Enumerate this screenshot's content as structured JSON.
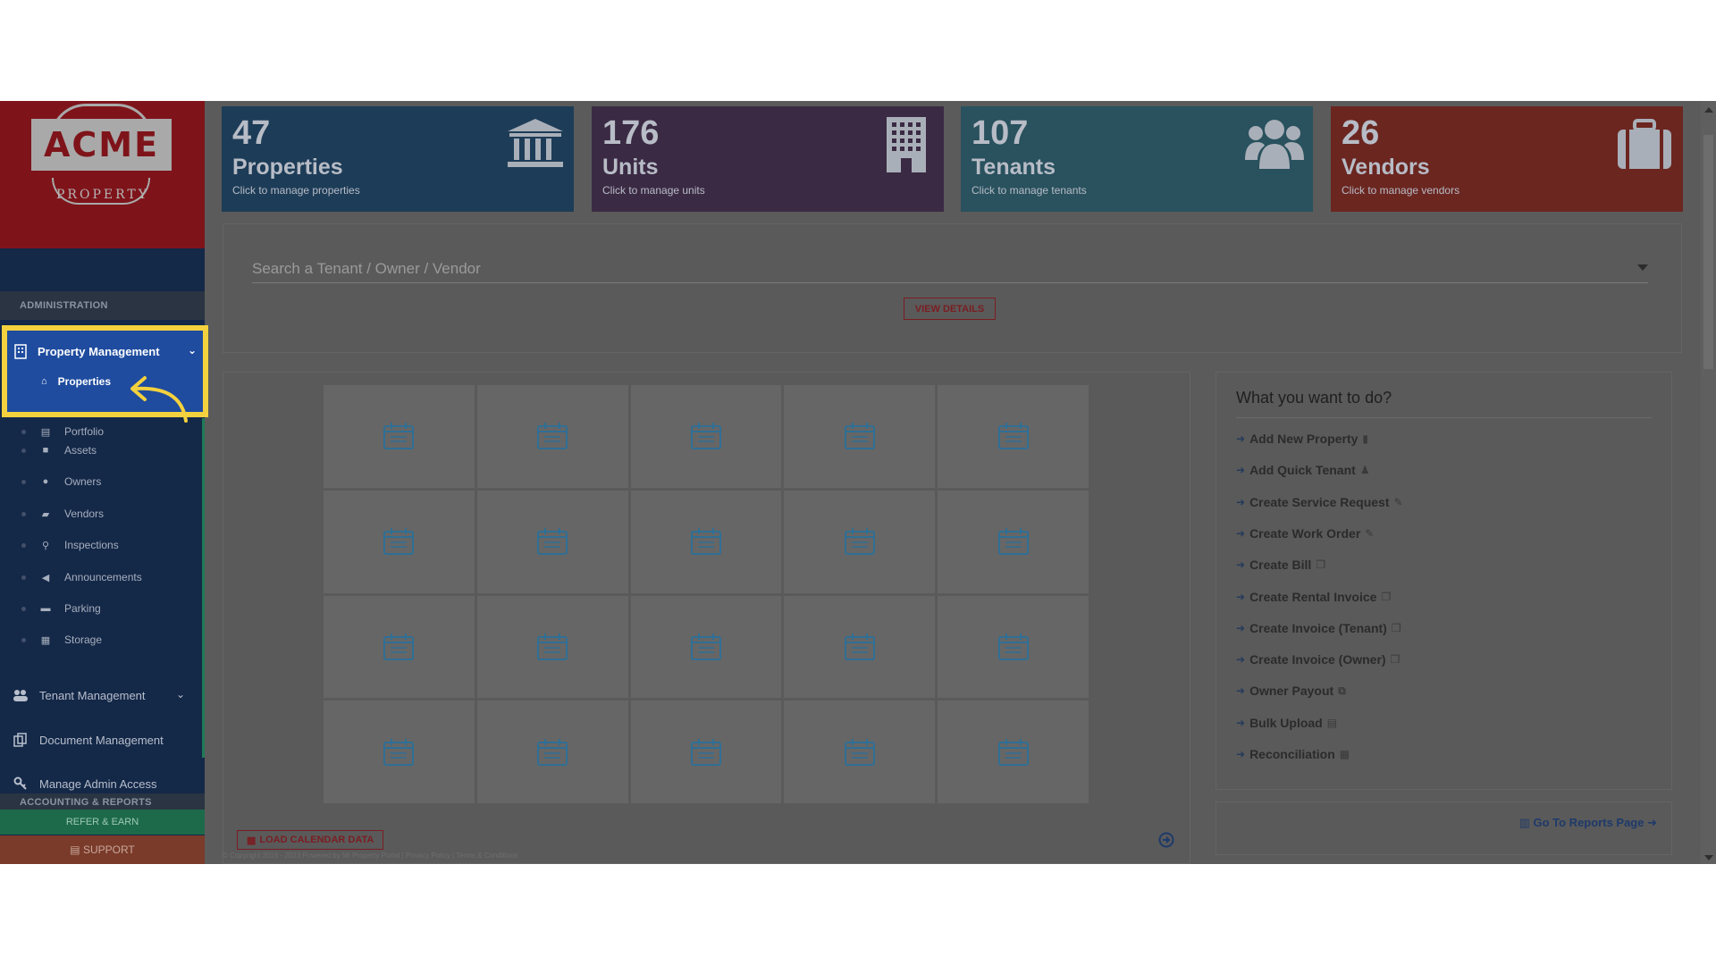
{
  "brand": {
    "name": "ACME",
    "tagline": "PROPERTY"
  },
  "colors": {
    "highlight": "#f4d13e",
    "sidebar": "#142848",
    "active_nav": "#1f4c9f",
    "properties_card": "#1d3c57",
    "units_card": "#3b2a44",
    "tenants_card": "#29515e",
    "vendors_card": "#6b2620"
  },
  "sidebar": {
    "section_admin": "ADMINISTRATION",
    "property_management": "Property Management",
    "property_items": [
      {
        "label": "Properties",
        "icon": "home-icon"
      },
      {
        "label": "Portfolio",
        "icon": "portfolio-icon"
      },
      {
        "label": "Assets",
        "icon": "assets-icon"
      },
      {
        "label": "Owners",
        "icon": "user-icon"
      },
      {
        "label": "Vendors",
        "icon": "briefcase-icon"
      },
      {
        "label": "Inspections",
        "icon": "search-icon"
      },
      {
        "label": "Announcements",
        "icon": "bullhorn-icon"
      },
      {
        "label": "Parking",
        "icon": "car-icon"
      },
      {
        "label": "Storage",
        "icon": "archive-icon"
      }
    ],
    "tenant_management": "Tenant Management",
    "document_management": "Document Management",
    "manage_admin_access": "Manage Admin Access",
    "section_accounting": "ACCOUNTING & REPORTS",
    "refer_label": "REFER & EARN",
    "support_label": "SUPPORT"
  },
  "stats": [
    {
      "count": "47",
      "label": "Properties",
      "sub": "Click to manage properties",
      "icon": "bank-icon"
    },
    {
      "count": "176",
      "label": "Units",
      "sub": "Click to manage units",
      "icon": "building-icon"
    },
    {
      "count": "107",
      "label": "Tenants",
      "sub": "Click to manage tenants",
      "icon": "users-icon"
    },
    {
      "count": "26",
      "label": "Vendors",
      "sub": "Click to manage vendors",
      "icon": "briefcase-icon"
    }
  ],
  "search": {
    "placeholder": "Search a Tenant / Owner / Vendor",
    "button": "VIEW DETAILS"
  },
  "calendar": {
    "load_button": "LOAD CALENDAR DATA"
  },
  "actions": {
    "title": "What you want to do?",
    "items": [
      {
        "label": "Add New Property",
        "icon": "building-icon"
      },
      {
        "label": "Add Quick Tenant",
        "icon": "user-icon"
      },
      {
        "label": "Create Service Request",
        "icon": "wrench-icon"
      },
      {
        "label": "Create Work Order",
        "icon": "wrench-icon"
      },
      {
        "label": "Create Bill",
        "icon": "copy-icon"
      },
      {
        "label": "Create Rental Invoice",
        "icon": "copy-icon"
      },
      {
        "label": "Create Invoice (Tenant)",
        "icon": "copy-icon"
      },
      {
        "label": "Create Invoice (Owner)",
        "icon": "copy-icon"
      },
      {
        "label": "Owner Payout",
        "icon": "clone-icon"
      },
      {
        "label": "Bulk Upload",
        "icon": "database-icon"
      },
      {
        "label": "Reconciliation",
        "icon": "calculator-icon"
      }
    ],
    "reports_link": "Go To Reports Page"
  },
  "footer": "© Copyright 2016 - 2023 Powered by MI Property Portal | Privacy Policy | Terms & Conditions"
}
